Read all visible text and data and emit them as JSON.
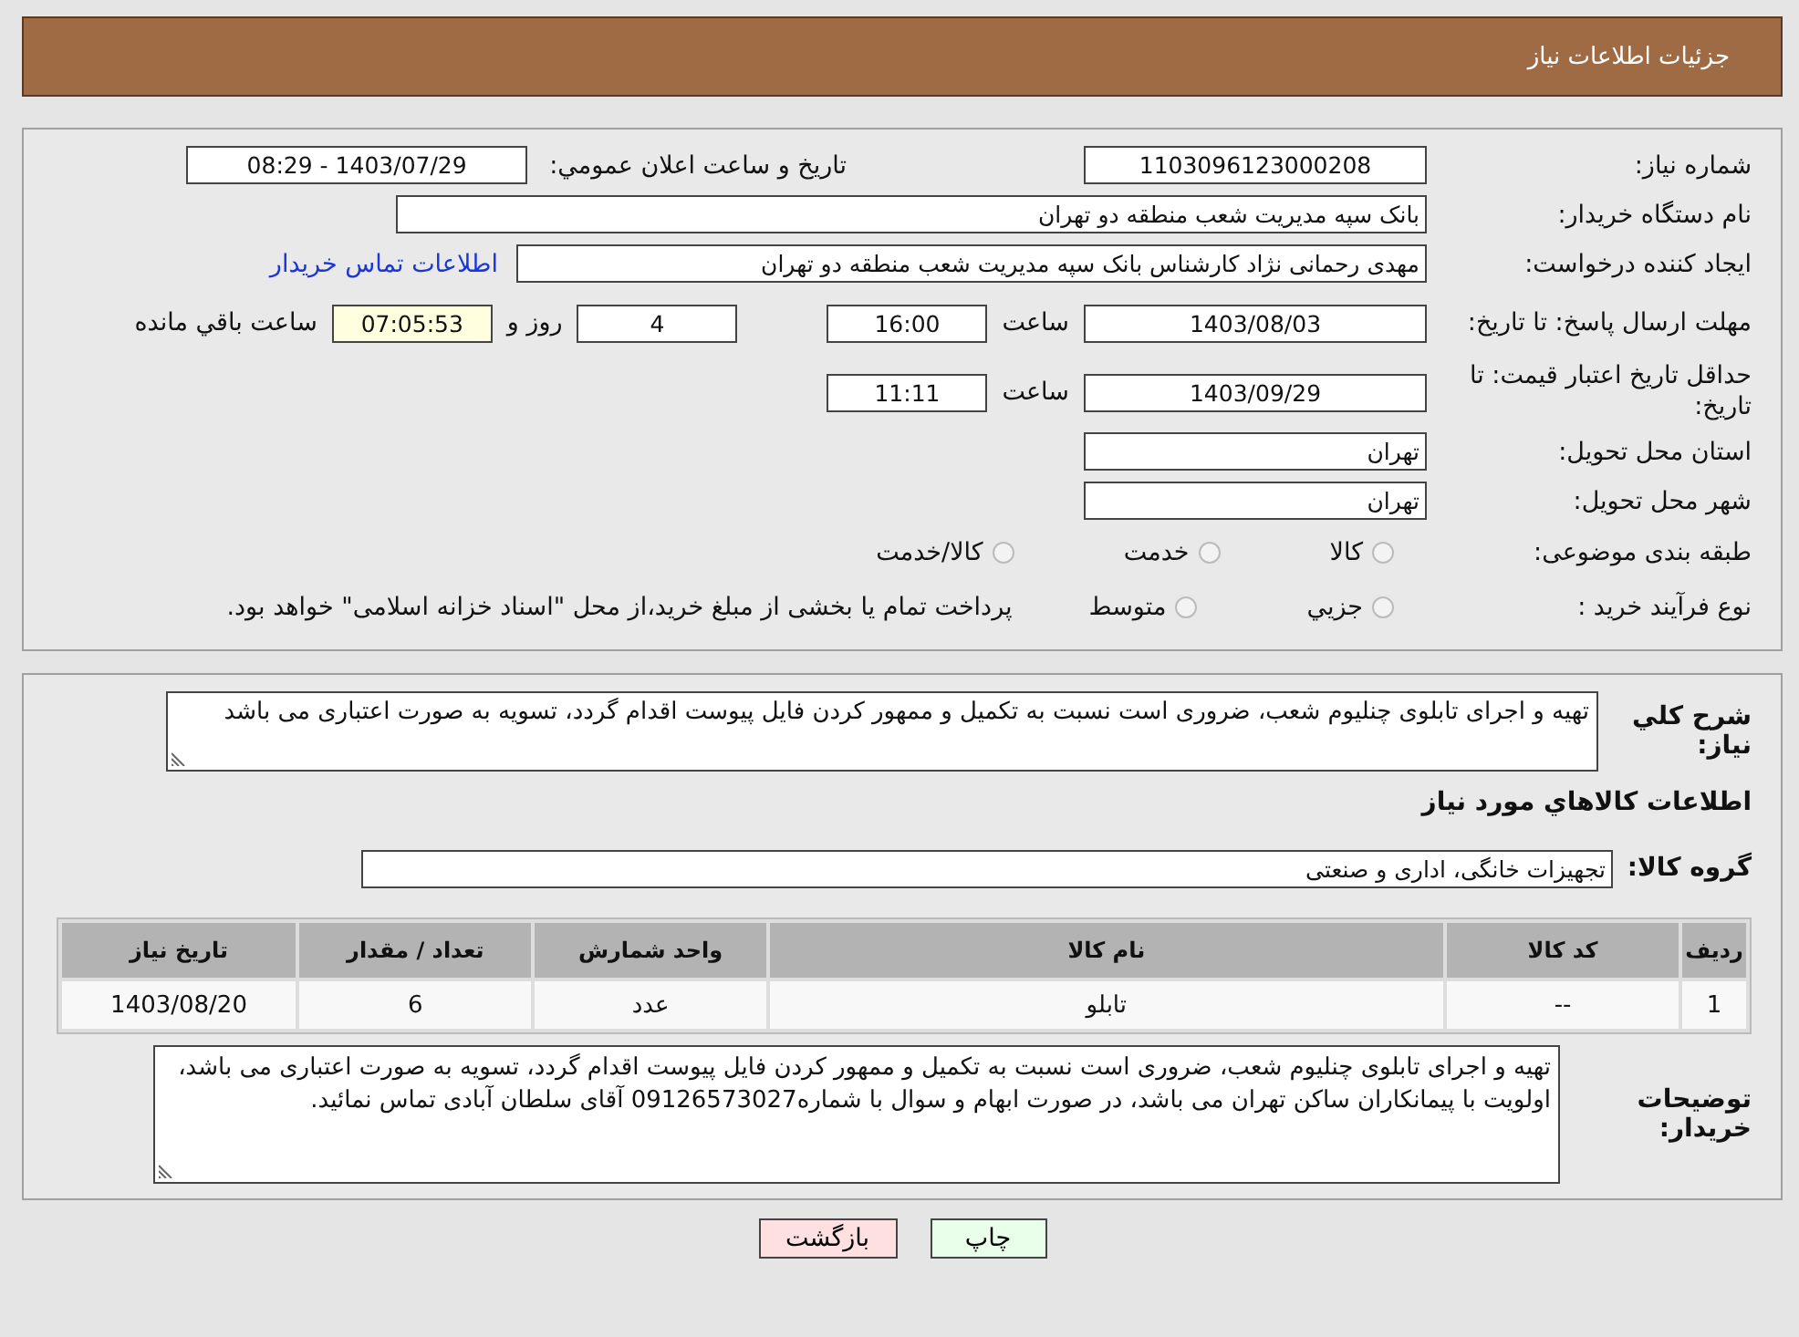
{
  "header": {
    "title": "جزئیات اطلاعات نیاز"
  },
  "details": {
    "need_number": {
      "label": "شماره نیاز:",
      "value": "1103096123000208"
    },
    "announce": {
      "label": "تاریخ و ساعت اعلان عمومي:",
      "value": "1403/07/29 - 08:29"
    },
    "buyer": {
      "label": "نام دستگاه خریدار:",
      "value": "بانک سپه مدیریت شعب منطقه دو تهران"
    },
    "creator": {
      "label": "ایجاد کننده درخواست:",
      "value": "مهدی رحمانی نژاد کارشناس بانک سپه مدیریت شعب منطقه دو تهران",
      "link": "اطلاعات تماس خریدار"
    },
    "deadline": {
      "label": "مهلت ارسال پاسخ: تا تاریخ:",
      "date": "1403/08/03",
      "time_label": "ساعت",
      "time": "16:00",
      "days": "4",
      "days_label": "روز و",
      "remaining": "07:05:53",
      "remaining_label": "ساعت باقي مانده"
    },
    "validity": {
      "label": "حداقل تاریخ اعتبار قیمت: تا تاریخ:",
      "date": "1403/09/29",
      "time_label": "ساعت",
      "time": "11:11"
    },
    "province": {
      "label": "استان محل تحویل:",
      "value": "تهران"
    },
    "city": {
      "label": "شهر محل تحویل:",
      "value": "تهران"
    },
    "category": {
      "label": "طبقه بندی موضوعی:",
      "options": [
        {
          "label": "کالا",
          "selected": false
        },
        {
          "label": "خدمت",
          "selected": false
        },
        {
          "label": "کالا/خدمت",
          "selected": false
        }
      ]
    },
    "purchase_type": {
      "label": "نوع فرآیند خرید :",
      "options": [
        {
          "label": "جزیي",
          "selected": false
        },
        {
          "label": "متوسط",
          "selected": false
        }
      ],
      "note": "پرداخت تمام یا بخشی از مبلغ خرید،از محل \"اسناد خزانه اسلامی\" خواهد بود."
    }
  },
  "need": {
    "description_label": "شرح کلي نیاز:",
    "description": "تهیه و اجرای تابلوی چنلیوم شعب، ضروری است نسبت به تکمیل و ممهور کردن فایل پیوست اقدام گردد، تسویه به صورت اعتباری می باشد",
    "goods_heading": "اطلاعات کالاهاي مورد نیاز",
    "group_label": "گروه کالا:",
    "group": "تجهیزات خانگی، اداری و صنعتی",
    "table": {
      "columns": [
        "ردیف",
        "کد کالا",
        "نام کالا",
        "واحد شمارش",
        "تعداد / مقدار",
        "تاریخ نیاز"
      ],
      "rows": [
        [
          "1",
          "--",
          "تابلو",
          "عدد",
          "6",
          "1403/08/20"
        ]
      ]
    },
    "notes_label": "توضیحات خریدار:",
    "notes": "تهیه و اجرای تابلوی چنلیوم شعب، ضروری است نسبت به تکمیل و ممهور کردن فایل پیوست اقدام گردد، تسویه به صورت اعتباری می باشد، اولویت با پیمانکاران ساکن تهران می باشد، در صورت  ابهام و سوال با شماره09126573027 آقای سلطان آبادی تماس نمائید."
  },
  "buttons": [
    {
      "label": "چاپ",
      "kind": "print"
    },
    {
      "label": "بازگشت",
      "kind": "back"
    }
  ]
}
